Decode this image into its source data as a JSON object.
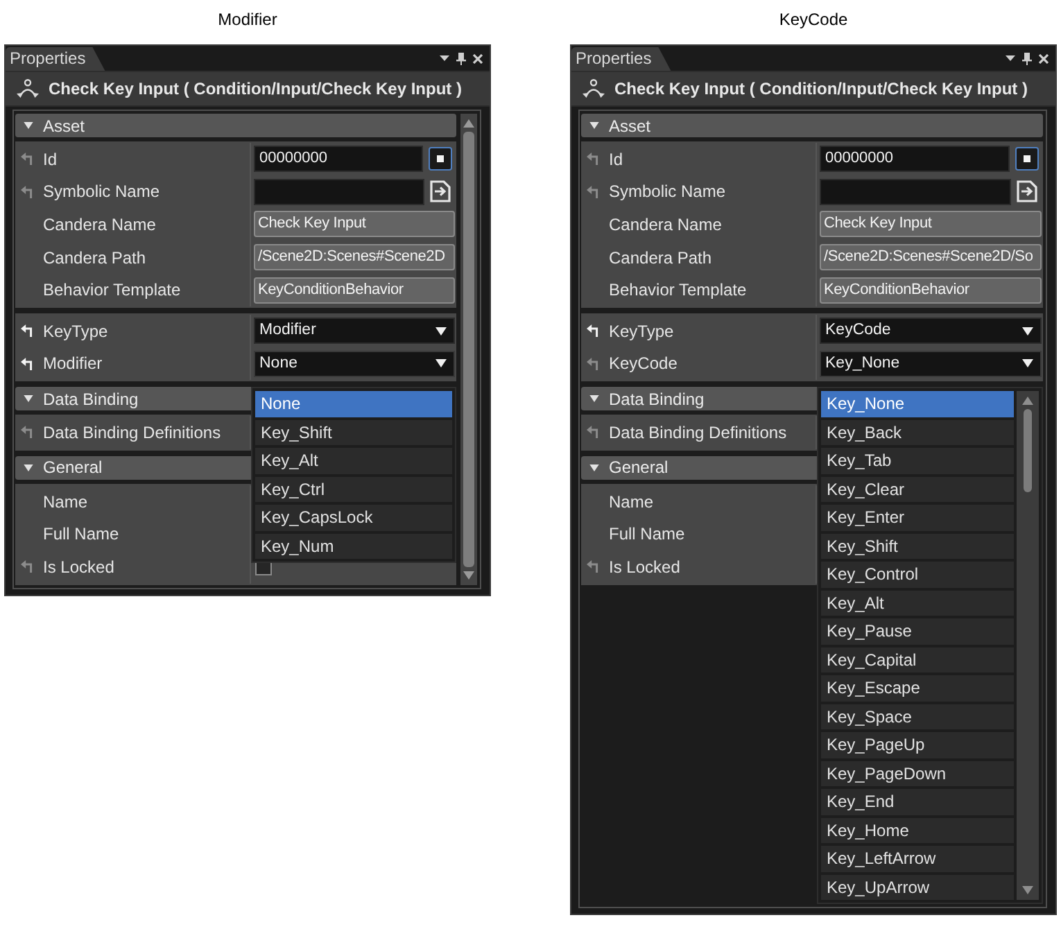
{
  "panels": [
    {
      "caption": "Modifier",
      "tab": "Properties",
      "title": "Check Key Input ( Condition/Input/Check Key Input )",
      "scrollbar": true,
      "groups": [
        {
          "label": "Asset",
          "expanded": true,
          "rows": [
            {
              "label": "Id",
              "reset_icon": true,
              "modified": false,
              "kind": "idfield",
              "value": "00000000"
            },
            {
              "label": "Symbolic Name",
              "reset_icon": true,
              "modified": false,
              "kind": "namefield"
            },
            {
              "label": "Candera Name",
              "reset_icon": false,
              "kind": "readonly",
              "value": "Check Key Input"
            },
            {
              "label": "Candera Path",
              "reset_icon": false,
              "kind": "readonly",
              "value": "/Scene2D:Scenes#Scene2D"
            },
            {
              "label": "Behavior Template",
              "reset_icon": false,
              "kind": "readonly",
              "value": "KeyConditionBehavior"
            }
          ]
        },
        {
          "rows": [
            {
              "label": "KeyType",
              "reset_icon": true,
              "modified": true,
              "kind": "dropdown",
              "value": "Modifier",
              "open": false
            },
            {
              "label": "Modifier",
              "reset_icon": true,
              "modified": true,
              "kind": "dropdown",
              "value": "None",
              "open": true,
              "list_scrollbar": false,
              "options": [
                {
                  "label": "None",
                  "selected": true
                },
                {
                  "label": "Key_Shift",
                  "selected": false
                },
                {
                  "label": "Key_Alt",
                  "selected": false
                },
                {
                  "label": "Key_Ctrl",
                  "selected": false
                },
                {
                  "label": "Key_CapsLock",
                  "selected": false
                },
                {
                  "label": "Key_Num",
                  "selected": false
                }
              ]
            }
          ]
        },
        {
          "label": "Data Binding",
          "expanded": true,
          "rows": [
            {
              "label": "Data Binding Definitions",
              "reset_icon": true,
              "modified": false
            }
          ]
        },
        {
          "label": "General",
          "expanded": true,
          "rows": [
            {
              "label": "Name",
              "reset_icon": false
            },
            {
              "label": "Full Name",
              "reset_icon": false
            },
            {
              "label": "Is Locked",
              "reset_icon": true,
              "modified": false,
              "kind": "checkbox",
              "checked": false
            }
          ]
        }
      ]
    },
    {
      "caption": "KeyCode",
      "tab": "Properties",
      "title": "Check Key Input ( Condition/Input/Check Key Input )",
      "scrollbar": false,
      "groups": [
        {
          "label": "Asset",
          "expanded": true,
          "rows": [
            {
              "label": "Id",
              "reset_icon": true,
              "modified": false,
              "kind": "idfield",
              "value": "00000000"
            },
            {
              "label": "Symbolic Name",
              "reset_icon": true,
              "modified": false,
              "kind": "namefield"
            },
            {
              "label": "Candera Name",
              "reset_icon": false,
              "kind": "readonly",
              "value": "Check Key Input"
            },
            {
              "label": "Candera Path",
              "reset_icon": false,
              "kind": "readonly",
              "value": "/Scene2D:Scenes#Scene2D/So"
            },
            {
              "label": "Behavior Template",
              "reset_icon": false,
              "kind": "readonly",
              "value": "KeyConditionBehavior"
            }
          ]
        },
        {
          "rows": [
            {
              "label": "KeyType",
              "reset_icon": true,
              "modified": true,
              "kind": "dropdown",
              "value": "KeyCode",
              "open": false
            },
            {
              "label": "KeyCode",
              "reset_icon": true,
              "modified": false,
              "kind": "dropdown",
              "value": "Key_None",
              "open": true,
              "list_scrollbar": true,
              "options": [
                {
                  "label": "Key_None",
                  "selected": true
                },
                {
                  "label": "Key_Back",
                  "selected": false
                },
                {
                  "label": "Key_Tab",
                  "selected": false
                },
                {
                  "label": "Key_Clear",
                  "selected": false
                },
                {
                  "label": "Key_Enter",
                  "selected": false
                },
                {
                  "label": "Key_Shift",
                  "selected": false
                },
                {
                  "label": "Key_Control",
                  "selected": false
                },
                {
                  "label": "Key_Alt",
                  "selected": false
                },
                {
                  "label": "Key_Pause",
                  "selected": false
                },
                {
                  "label": "Key_Capital",
                  "selected": false
                },
                {
                  "label": "Key_Escape",
                  "selected": false
                },
                {
                  "label": "Key_Space",
                  "selected": false
                },
                {
                  "label": "Key_PageUp",
                  "selected": false
                },
                {
                  "label": "Key_PageDown",
                  "selected": false
                },
                {
                  "label": "Key_End",
                  "selected": false
                },
                {
                  "label": "Key_Home",
                  "selected": false
                },
                {
                  "label": "Key_LeftArrow",
                  "selected": false
                },
                {
                  "label": "Key_UpArrow",
                  "selected": false
                }
              ]
            }
          ]
        },
        {
          "label": "Data Binding",
          "expanded": true,
          "rows": [
            {
              "label": "Data Binding Definitions",
              "reset_icon": true,
              "modified": false
            }
          ]
        },
        {
          "label": "General",
          "expanded": true,
          "rows": [
            {
              "label": "Name",
              "reset_icon": false
            },
            {
              "label": "Full Name",
              "reset_icon": false
            },
            {
              "label": "Is Locked",
              "reset_icon": true,
              "modified": false
            }
          ]
        }
      ]
    }
  ]
}
